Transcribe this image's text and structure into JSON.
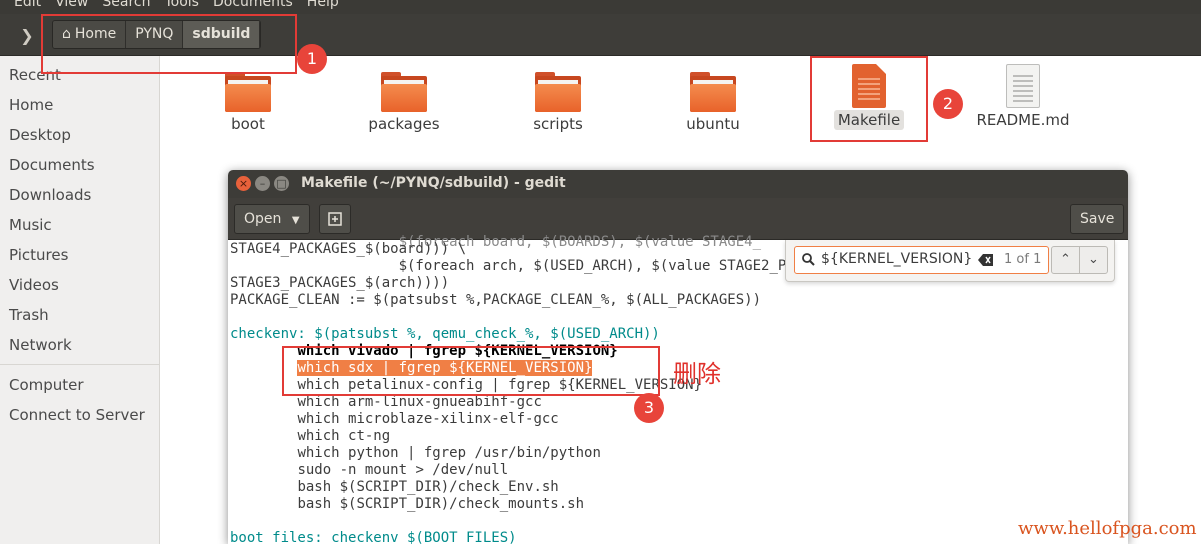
{
  "menubar": {
    "items": [
      "Edit",
      "View",
      "Search",
      "Tools",
      "Documents",
      "Help"
    ]
  },
  "pathbar": {
    "crumbs": [
      "Home",
      "PYNQ",
      "sdbuild"
    ]
  },
  "sidebar": {
    "items": [
      "Recent",
      "Home",
      "Desktop",
      "Documents",
      "Downloads",
      "Music",
      "Pictures",
      "Videos",
      "Trash",
      "Network"
    ],
    "other": [
      "Computer",
      "Connect to Server"
    ]
  },
  "files": [
    {
      "name": "boot",
      "type": "folder"
    },
    {
      "name": "packages",
      "type": "folder"
    },
    {
      "name": "scripts",
      "type": "folder"
    },
    {
      "name": "ubuntu",
      "type": "folder"
    },
    {
      "name": "Makefile",
      "type": "makefile",
      "selected": true
    },
    {
      "name": "README.md",
      "type": "text"
    }
  ],
  "annotations": {
    "num1": "1",
    "num2": "2",
    "num3": "3",
    "delete_note": "删除"
  },
  "gedit": {
    "title": "Makefile (~/PYNQ/sdbuild) - gedit",
    "open_label": "Open",
    "save_label": "Save",
    "search": {
      "query": "${KERNEL_VERSION}",
      "count": "1 of 1"
    }
  },
  "code": {
    "l0": "STAGE4_PACKAGES_$(board))) \\",
    "l1": "                    $(foreach arch, $(USED_ARCH), $(value STAGE2_P",
    "l2": "STAGE3_PACKAGES_$(arch))))",
    "l3": "PACKAGE_CLEAN := $(patsubst %,PACKAGE_CLEAN_%, $(ALL_PACKAGES))",
    "l5": "checkenv: $(patsubst %, qemu_check_%, $(USED_ARCH))",
    "l6": "which vivado | fgrep ${KERNEL_VERSION}",
    "l7": "which sdx | fgrep ${KERNEL_VERSION}",
    "l8": "which petalinux-config | fgrep ${KERNEL_VERSION}",
    "l9": "which arm-linux-gnueabihf-gcc",
    "l10": "which microblaze-xilinx-elf-gcc",
    "l11": "which ct-ng",
    "l12": "which python | fgrep /usr/bin/python",
    "l13": "sudo -n mount > /dev/null",
    "l14": "bash $(SCRIPT_DIR)/check_Env.sh",
    "l15": "bash $(SCRIPT_DIR)/check_mounts.sh",
    "l17": "boot_files: checkenv $(BOOT_FILES)"
  },
  "watermark": "www.hellofpga.com",
  "colors": {
    "accent": "#f07f45",
    "annotation": "#e23b36",
    "folder": "#e8622a"
  }
}
